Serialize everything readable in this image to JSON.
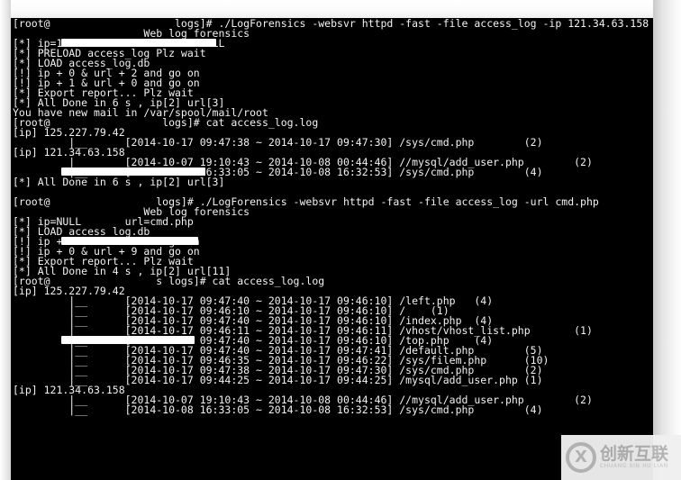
{
  "window": {
    "type": "terminal",
    "background_color": "#000000",
    "foreground_color": "#f2f2f2",
    "page_background_color": "#ffffff"
  },
  "terminal": {
    "prompt_user": "[root@",
    "prompt_tail_1": "logs]#",
    "lines": [
      "[root@                    logs]# ./LogForensics -websvr httpd -fast -file access_log -ip 121.34.63.158",
      "                     Web log forensics",
      "[*] ip=121.34.63.158      url=NULL",
      "[*] PRELOAD access_log Plz wait",
      "[*] LOAD access_log.db",
      "[!] ip + 0 & url + 2 and go on",
      "[!] ip + 1 & url + 0 and go on",
      "[*] Export report... Plz wait",
      "[*] All Done in 6 s , ip[2] url[3]",
      "You have new mail in /var/spool/mail/root",
      "[root@                  logs]# cat access_log.log",
      "[ip] 125.227.79.42",
      "         |__      [2014-10-17 09:47:38 ~ 2014-10-17 09:47:30] /sys/cmd.php        (2)",
      "[ip] 121.34.63.158",
      "         |__      [2014-10-07 19:10:43 ~ 2014-10-08 00:44:46] //mysql/add_user.php        (2)",
      "         |__      [2014-10-08 16:33:05 ~ 2014-10-08 16:32:53] /sys/cmd.php        (4)",
      "[*] All Done in 6 s , ip[2] url[3]",
      "[root@                 logs]# ./LogForensics -websvr httpd -fast -file access_log -url cmd.php",
      "                     Web log forensics",
      "[*] ip=NULL       url=cmd.php",
      "[*] LOAD access_log.db",
      "[!] ip + 2 & url + 0 and go on",
      "[!] ip + 0 & url + 9 and go on",
      "[*] Export report... Plz wait",
      "[*] All Done in 4 s , ip[2] url[11]",
      "[root@                 s logs]# cat access_log.log",
      "[ip] 125.227.79.42",
      "         |__      [2014-10-17 09:47:40 ~ 2014-10-17 09:46:10] /left.php   (4)",
      "         |__      [2014-10-17 09:46:10 ~ 2014-10-17 09:46:10] /    (1)",
      "         |__      [2014-10-17 09:47:40 ~ 2014-10-17 09:46:10] /index.php  (4)",
      "         |__      [2014-10-17 09:46:11 ~ 2014-10-17 09:46:11] /vhost/vhost_list.php       (1)",
      "         |__      [2014-10-17 09:47:40 ~ 2014-10-17 09:46:10] /top.php    (4)",
      "         |__      [2014-10-17 09:47:40 ~ 2014-10-17 09:47:41] /default.php        (5)",
      "         |__      [2014-10-17 09:46:35 ~ 2014-10-17 09:46:22] /sys/filem.php      (10)",
      "         |__      [2014-10-17 09:47:38 ~ 2014-10-17 09:47:30] /sys/cmd.php        (2)",
      "         |__      [2014-10-17 09:44:25 ~ 2014-10-17 09:44:25] /mysql/add_user.php (1)",
      "[ip] 121.34.63.158",
      "         |__      [2014-10-07 19:10:43 ~ 2014-10-08 00:44:46] //mysql/add_user.php        (2)",
      "         |__      [2014-10-08 16:33:05 ~ 2014-10-08 16:32:53] /sys/cmd.php        (4)"
    ],
    "blank_line_indices": [
      16
    ]
  },
  "commands": [
    {
      "index": 1,
      "binary": "./LogForensics",
      "flags": [
        "-websvr httpd",
        "-fast",
        "-file access_log",
        "-ip 121.34.63.158"
      ],
      "banner": "Web log forensics",
      "ip_param": "121.34.63.158",
      "url_param": "NULL",
      "duration": "6 s",
      "ip_count": "2",
      "url_count": "3"
    },
    {
      "index": 2,
      "binary": "./LogForensics",
      "flags": [
        "-websvr httpd",
        "-fast",
        "-file access_log",
        "-url cmd.php"
      ],
      "banner": "Web log forensics",
      "ip_param": "NULL",
      "url_param": "cmd.php",
      "duration": "4 s",
      "ip_count": "2",
      "url_count": "11"
    }
  ],
  "report_1": {
    "groups": [
      {
        "ip": "125.227.79.42",
        "entries": [
          {
            "start": "2014-10-17 09:47:38",
            "end": "2014-10-17 09:47:30",
            "url": "/sys/cmd.php",
            "count": "(2)"
          }
        ]
      },
      {
        "ip": "121.34.63.158",
        "entries": [
          {
            "start": "2014-10-07 19:10:43",
            "end": "2014-10-08 00:44:46",
            "url": "//mysql/add_user.php",
            "count": "(2)"
          },
          {
            "start": "2014-10-08 16:33:05",
            "end": "2014-10-08 16:32:53",
            "url": "/sys/cmd.php",
            "count": "(4)"
          }
        ]
      }
    ]
  },
  "report_2": {
    "groups": [
      {
        "ip": "125.227.79.42",
        "entries": [
          {
            "start": "2014-10-17 09:47:40",
            "end": "2014-10-17 09:46:10",
            "url": "/left.php",
            "count": "(4)"
          },
          {
            "start": "2014-10-17 09:46:10",
            "end": "2014-10-17 09:46:10",
            "url": "/",
            "count": "(1)"
          },
          {
            "start": "2014-10-17 09:47:40",
            "end": "2014-10-17 09:46:10",
            "url": "/index.php",
            "count": "(4)"
          },
          {
            "start": "2014-10-17 09:46:11",
            "end": "2014-10-17 09:46:11",
            "url": "/vhost/vhost_list.php",
            "count": "(1)"
          },
          {
            "start": "2014-10-17 09:47:40",
            "end": "2014-10-17 09:46:10",
            "url": "/top.php",
            "count": "(4)"
          },
          {
            "start": "2014-10-17 09:47:40",
            "end": "2014-10-17 09:47:41",
            "url": "/default.php",
            "count": "(5)"
          },
          {
            "start": "2014-10-17 09:46:35",
            "end": "2014-10-17 09:46:22",
            "url": "/sys/filem.php",
            "count": "(10)"
          },
          {
            "start": "2014-10-17 09:47:38",
            "end": "2014-10-17 09:47:30",
            "url": "/sys/cmd.php",
            "count": "(2)"
          },
          {
            "start": "2014-10-17 09:44:25",
            "end": "2014-10-17 09:44:25",
            "url": "/mysql/add_user.php",
            "count": "(1)"
          }
        ]
      },
      {
        "ip": "121.34.63.158",
        "entries": [
          {
            "start": "2014-10-07 19:10:43",
            "end": "2014-10-08 00:44:46",
            "url": "//mysql/add_user.php",
            "count": "(2)"
          },
          {
            "start": "2014-10-08 16:33:05",
            "end": "2014-10-08 16:32:53",
            "url": "/sys/cmd.php",
            "count": "(4)"
          }
        ]
      }
    ]
  },
  "mail_notice": "You have new mail in /var/spool/mail/root",
  "watermark": {
    "logo_glyph": "X",
    "chinese": "创新互联",
    "pinyin": "CHUANG XIN HU LIAN"
  }
}
